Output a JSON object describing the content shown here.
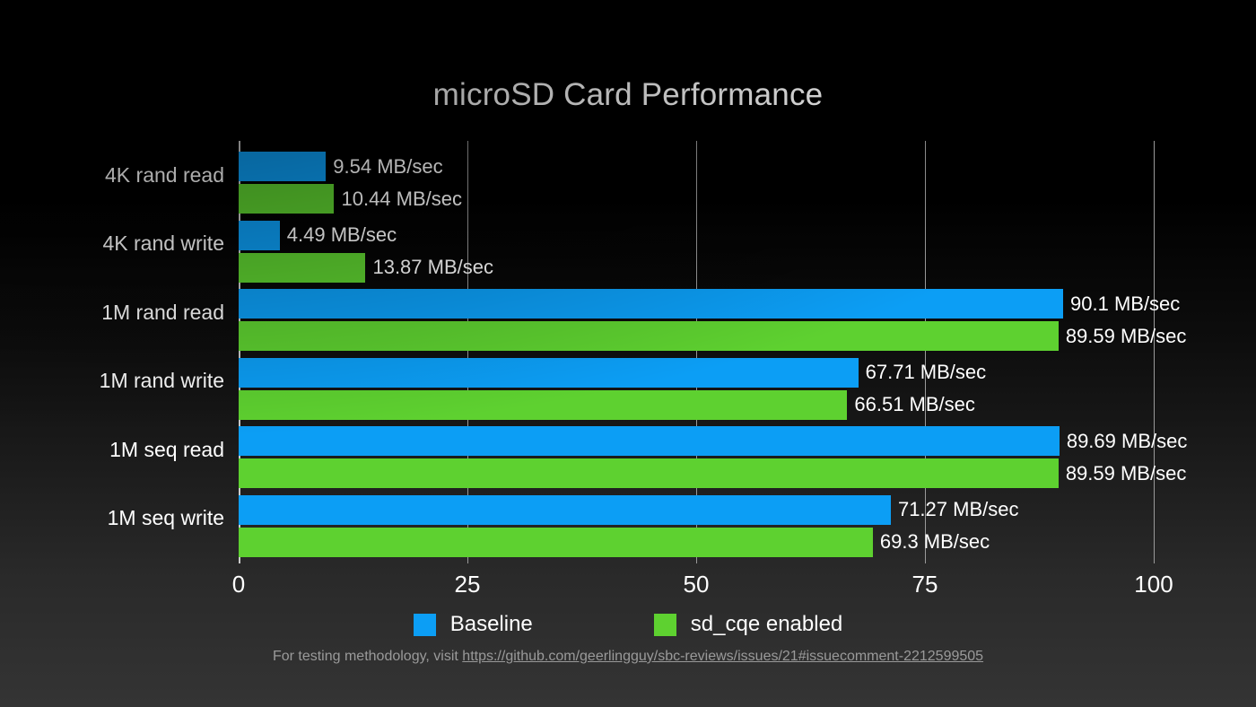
{
  "chart_data": {
    "type": "bar",
    "orientation": "horizontal",
    "title": "microSD Card Performance",
    "xlabel": "",
    "ylabel": "",
    "xlim": [
      0,
      100
    ],
    "xticks": [
      0,
      25,
      50,
      75,
      100
    ],
    "xtick_labels": [
      "0",
      "25",
      "50",
      "75",
      "100"
    ],
    "grid": true,
    "grid_axis": "x",
    "legend_position": "bottom",
    "unit": "MB/sec",
    "categories": [
      "4K rand read",
      "4K rand write",
      "1M rand read",
      "1M rand write",
      "1M seq read",
      "1M seq write"
    ],
    "series": [
      {
        "name": "Baseline",
        "color": "#0c9ef5",
        "values": [
          9.54,
          4.49,
          90.1,
          67.71,
          89.69,
          71.27
        ],
        "labels": [
          "9.54 MB/sec",
          "4.49 MB/sec",
          "90.1 MB/sec",
          "67.71 MB/sec",
          "89.69 MB/sec",
          "71.27 MB/sec"
        ]
      },
      {
        "name": "sd_cqe enabled",
        "color": "#5ed130",
        "values": [
          10.44,
          13.87,
          89.59,
          66.51,
          89.59,
          69.3
        ],
        "labels": [
          "10.44 MB/sec",
          "13.87 MB/sec",
          "89.59 MB/sec",
          "66.51 MB/sec",
          "89.59 MB/sec",
          "69.3 MB/sec"
        ]
      }
    ]
  },
  "footer": {
    "prefix": "For testing methodology, visit ",
    "url": "https://github.com/geerlingguy/sbc-reviews/issues/21#issuecomment-2212599505"
  },
  "colors": {
    "baseline": "#0c9ef5",
    "sd_cqe": "#5ed130",
    "background_top": "#000000",
    "background_bottom": "#343434",
    "text": "#ffffff",
    "gridline": "#9a9a9a",
    "footer_text": "#9a9a9a"
  }
}
